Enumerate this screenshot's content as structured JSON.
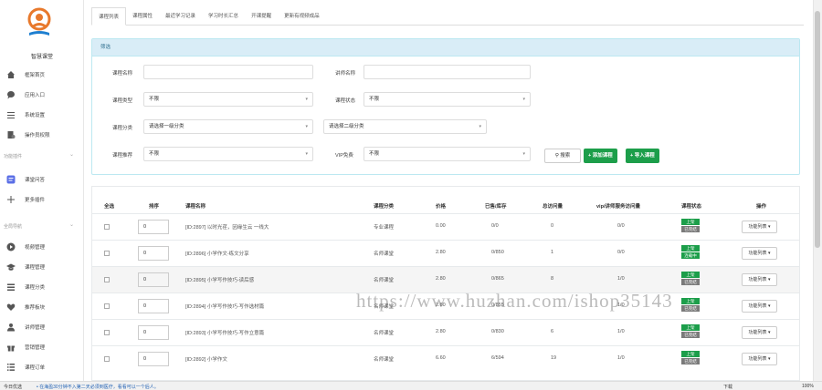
{
  "brand": {
    "name": "智慧课堂"
  },
  "sidebar": {
    "items": [
      {
        "label": "框架首页",
        "icon": "home-icon"
      },
      {
        "label": "应用入口",
        "icon": "chat-icon"
      },
      {
        "label": "系统设置",
        "icon": "list-icon"
      },
      {
        "label": "操作员权限",
        "icon": "user-tag-icon"
      }
    ],
    "section1": "功能插件",
    "plugins": [
      {
        "label": "课堂问答",
        "icon": "message-square-icon"
      },
      {
        "label": "更多插件",
        "icon": "plus-icon"
      }
    ],
    "section2": "全局导航",
    "nav": [
      {
        "label": "视频管理",
        "icon": "play-circle-icon"
      },
      {
        "label": "课程管理",
        "icon": "graduation-cap-icon"
      },
      {
        "label": "课程分类",
        "icon": "bars-icon"
      },
      {
        "label": "推荐板块",
        "icon": "heart-icon"
      },
      {
        "label": "讲师管理",
        "icon": "teacher-icon"
      },
      {
        "label": "营销管理",
        "icon": "gift-icon"
      },
      {
        "label": "课程订单",
        "icon": "order-list-icon"
      }
    ]
  },
  "tabs": [
    "课程列表",
    "课程属性",
    "最近学习记录",
    "学习时长汇总",
    "开课提醒",
    "更新有视频成品"
  ],
  "filter": {
    "title": "筛选",
    "course_name_label": "课程名称",
    "course_name_value": "",
    "teacher_name_label": "讲师名称",
    "teacher_name_value": "",
    "course_type_label": "课程类型",
    "course_type_value": "不限",
    "course_status_label": "课程状态",
    "course_status_value": "不限",
    "category_label": "课程分类",
    "category_value": "请选择一级分类",
    "subcategory_value": "请选择二级分类",
    "recommend_label": "课程推荐",
    "recommend_value": "不限",
    "is_free_label": "VIP免费",
    "is_free_value": "不限",
    "search_button": "搜索",
    "add_button": "+ 添加课程",
    "import_button": "+ 导入课程"
  },
  "table": {
    "headers": [
      "全选",
      "排序",
      "课程名称",
      "课程分类",
      "价格",
      "已售/库存",
      "总访问量",
      "vip/讲师服务访问量",
      "课程状态",
      "操作"
    ],
    "rows": [
      {
        "sort": "0",
        "name": "[ID:2897] 以时光荏，因缘生云 一线大",
        "category": "专业课程",
        "price": "0.00",
        "stock": "0/0",
        "visits": "0",
        "vip": "0/0",
        "status_top": "上架",
        "status_bottom": "已完结",
        "status_bottom_color": "#7a7a7a",
        "op": "功能列表"
      },
      {
        "sort": "0",
        "name": "[ID:2896] 小学作文-练文分享",
        "category": "名师课堂",
        "price": "2.80",
        "stock": "0/850",
        "visits": "1",
        "vip": "0/0",
        "status_top": "上架",
        "status_bottom": "连载中",
        "status_bottom_color": "#1c9e4a",
        "op": "功能列表"
      },
      {
        "sort": "0",
        "name": "[ID:2895] 小学写作技巧-读后感",
        "category": "名师课堂",
        "price": "2.80",
        "stock": "0/865",
        "visits": "8",
        "vip": "1/0",
        "status_top": "上架",
        "status_bottom": "已完结",
        "status_bottom_color": "#7a7a7a",
        "op": "功能列表"
      },
      {
        "sort": "0",
        "name": "[ID:2894] 小学写作技巧-写作选材篇",
        "category": "名师课堂",
        "price": "2.80",
        "stock": "0/855",
        "visits": "",
        "vip": "1/0",
        "status_top": "上架",
        "status_bottom": "已完结",
        "status_bottom_color": "#7a7a7a",
        "op": "功能列表"
      },
      {
        "sort": "0",
        "name": "[ID:2893] 小学写作技巧-写作立意篇",
        "category": "名师课堂",
        "price": "2.80",
        "stock": "0/830",
        "visits": "6",
        "vip": "1/0",
        "status_top": "上架",
        "status_bottom": "已完结",
        "status_bottom_color": "#7a7a7a",
        "op": "功能列表"
      },
      {
        "sort": "0",
        "name": "[ID:2892] 小学作文",
        "category": "名师课堂",
        "price": "6.60",
        "stock": "6/594",
        "visits": "19",
        "vip": "1/0",
        "status_top": "上架",
        "status_bottom": "已完结",
        "status_bottom_color": "#7a7a7a",
        "op": "功能列表"
      }
    ]
  },
  "watermark": "https://www.huzhan.com/ishop35143",
  "statusbar": {
    "left": "今日优选",
    "news": "• 在海盈30分钟不入第二天必须到医疗，看看可以一个后人。",
    "zoom": "100%",
    "download": "下载"
  },
  "colors": {
    "accent": "#1c9e4a",
    "panel_head": "#d9edf7",
    "logo": "#e8792c"
  }
}
